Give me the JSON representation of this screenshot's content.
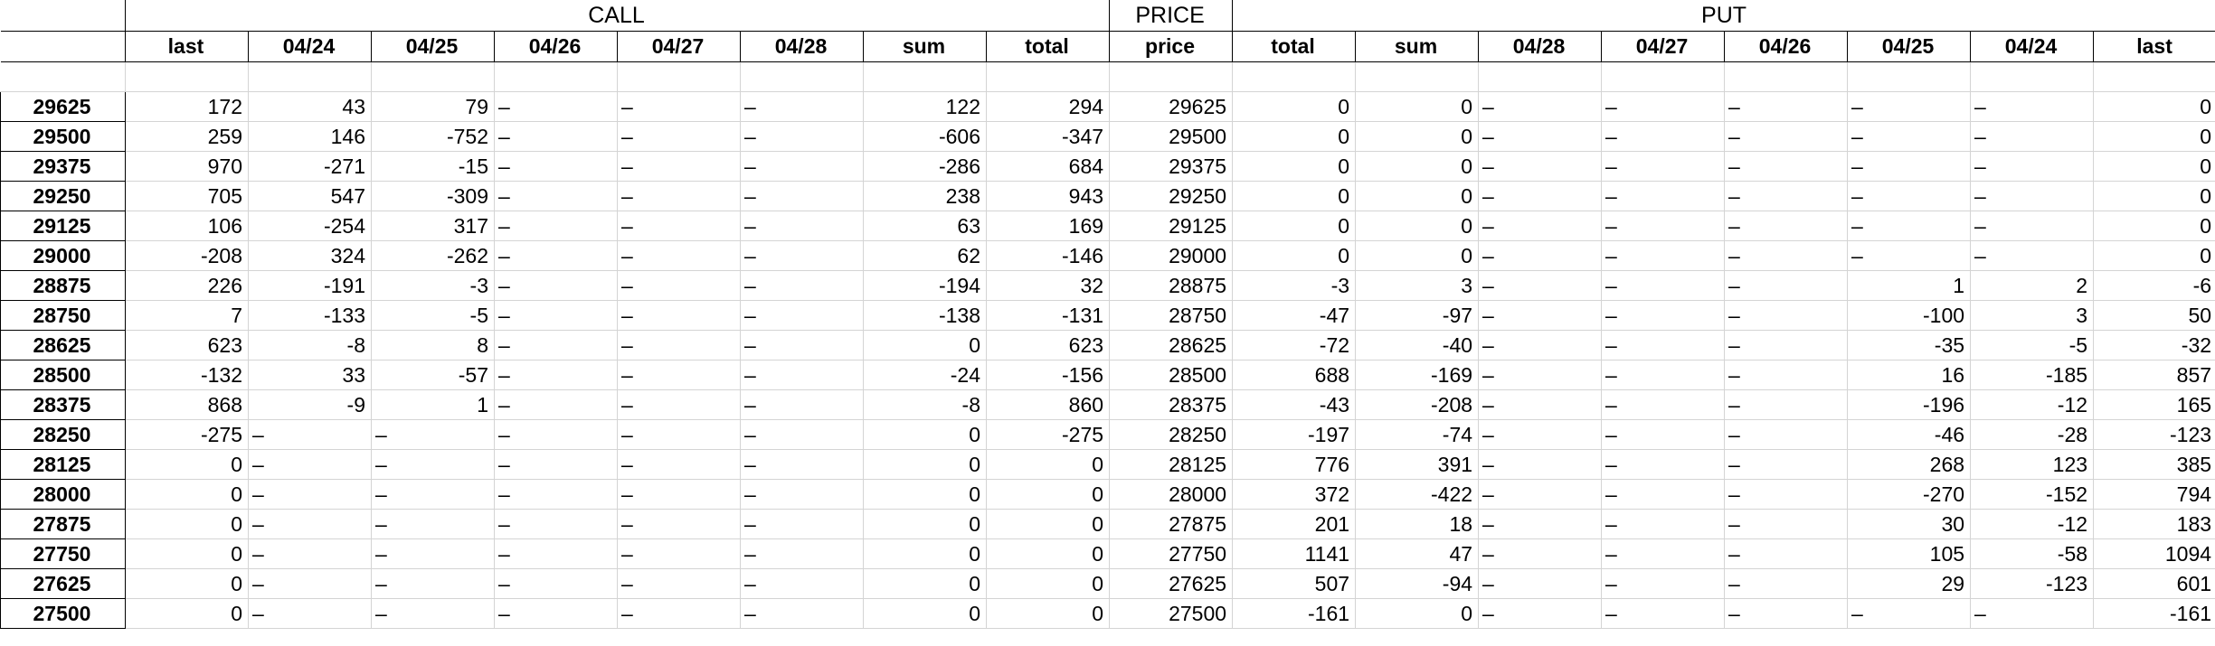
{
  "groups": {
    "call": "CALL",
    "price": "PRICE",
    "put": "PUT"
  },
  "columns": [
    "last",
    "04/24",
    "04/25",
    "04/26",
    "04/27",
    "04/28",
    "sum",
    "total",
    "price",
    "total",
    "sum",
    "04/28",
    "04/27",
    "04/26",
    "04/25",
    "04/24",
    "last"
  ],
  "rows": [
    {
      "label": "29625",
      "cells": [
        "172",
        "43",
        "79",
        "–",
        "–",
        "–",
        "122",
        "294",
        "29625",
        "0",
        "0",
        "–",
        "–",
        "–",
        "–",
        "–",
        "0"
      ]
    },
    {
      "label": "29500",
      "cells": [
        "259",
        "146",
        "-752",
        "–",
        "–",
        "–",
        "-606",
        "-347",
        "29500",
        "0",
        "0",
        "–",
        "–",
        "–",
        "–",
        "–",
        "0"
      ]
    },
    {
      "label": "29375",
      "cells": [
        "970",
        "-271",
        "-15",
        "–",
        "–",
        "–",
        "-286",
        "684",
        "29375",
        "0",
        "0",
        "–",
        "–",
        "–",
        "–",
        "–",
        "0"
      ]
    },
    {
      "label": "29250",
      "cells": [
        "705",
        "547",
        "-309",
        "–",
        "–",
        "–",
        "238",
        "943",
        "29250",
        "0",
        "0",
        "–",
        "–",
        "–",
        "–",
        "–",
        "0"
      ]
    },
    {
      "label": "29125",
      "cells": [
        "106",
        "-254",
        "317",
        "–",
        "–",
        "–",
        "63",
        "169",
        "29125",
        "0",
        "0",
        "–",
        "–",
        "–",
        "–",
        "–",
        "0"
      ]
    },
    {
      "label": "29000",
      "cells": [
        "-208",
        "324",
        "-262",
        "–",
        "–",
        "–",
        "62",
        "-146",
        "29000",
        "0",
        "0",
        "–",
        "–",
        "–",
        "–",
        "–",
        "0"
      ]
    },
    {
      "label": "28875",
      "cells": [
        "226",
        "-191",
        "-3",
        "–",
        "–",
        "–",
        "-194",
        "32",
        "28875",
        "-3",
        "3",
        "–",
        "–",
        "–",
        "1",
        "2",
        "-6"
      ]
    },
    {
      "label": "28750",
      "cells": [
        "7",
        "-133",
        "-5",
        "–",
        "–",
        "–",
        "-138",
        "-131",
        "28750",
        "-47",
        "-97",
        "–",
        "–",
        "–",
        "-100",
        "3",
        "50"
      ]
    },
    {
      "label": "28625",
      "cells": [
        "623",
        "-8",
        "8",
        "–",
        "–",
        "–",
        "0",
        "623",
        "28625",
        "-72",
        "-40",
        "–",
        "–",
        "–",
        "-35",
        "-5",
        "-32"
      ]
    },
    {
      "label": "28500",
      "cells": [
        "-132",
        "33",
        "-57",
        "–",
        "–",
        "–",
        "-24",
        "-156",
        "28500",
        "688",
        "-169",
        "–",
        "–",
        "–",
        "16",
        "-185",
        "857"
      ]
    },
    {
      "label": "28375",
      "cells": [
        "868",
        "-9",
        "1",
        "–",
        "–",
        "–",
        "-8",
        "860",
        "28375",
        "-43",
        "-208",
        "–",
        "–",
        "–",
        "-196",
        "-12",
        "165"
      ]
    },
    {
      "label": "28250",
      "cells": [
        "-275",
        "–",
        "–",
        "–",
        "–",
        "–",
        "0",
        "-275",
        "28250",
        "-197",
        "-74",
        "–",
        "–",
        "–",
        "-46",
        "-28",
        "-123"
      ]
    },
    {
      "label": "28125",
      "cells": [
        "0",
        "–",
        "–",
        "–",
        "–",
        "–",
        "0",
        "0",
        "28125",
        "776",
        "391",
        "–",
        "–",
        "–",
        "268",
        "123",
        "385"
      ]
    },
    {
      "label": "28000",
      "cells": [
        "0",
        "–",
        "–",
        "–",
        "–",
        "–",
        "0",
        "0",
        "28000",
        "372",
        "-422",
        "–",
        "–",
        "–",
        "-270",
        "-152",
        "794"
      ]
    },
    {
      "label": "27875",
      "cells": [
        "0",
        "–",
        "–",
        "–",
        "–",
        "–",
        "0",
        "0",
        "27875",
        "201",
        "18",
        "–",
        "–",
        "–",
        "30",
        "-12",
        "183"
      ]
    },
    {
      "label": "27750",
      "cells": [
        "0",
        "–",
        "–",
        "–",
        "–",
        "–",
        "0",
        "0",
        "27750",
        "1141",
        "47",
        "–",
        "–",
        "–",
        "105",
        "-58",
        "1094"
      ]
    },
    {
      "label": "27625",
      "cells": [
        "0",
        "–",
        "–",
        "–",
        "–",
        "–",
        "0",
        "0",
        "27625",
        "507",
        "-94",
        "–",
        "–",
        "–",
        "29",
        "-123",
        "601"
      ]
    },
    {
      "label": "27500",
      "cells": [
        "0",
        "–",
        "–",
        "–",
        "–",
        "–",
        "0",
        "0",
        "27500",
        "-161",
        "0",
        "–",
        "–",
        "–",
        "–",
        "–",
        "-161"
      ]
    }
  ]
}
